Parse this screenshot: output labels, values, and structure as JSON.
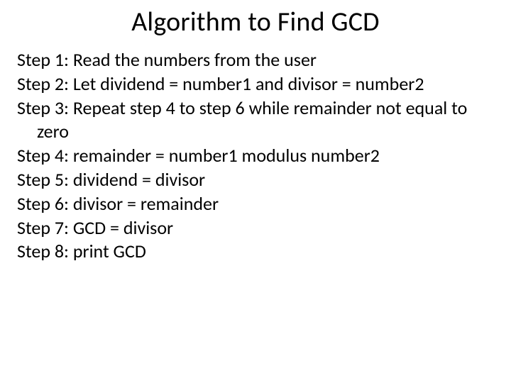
{
  "title": "Algorithm to Find GCD",
  "steps": {
    "s1": "Step 1: Read the numbers from the user",
    "s2": "Step 2: Let dividend = number1 and divisor = number2",
    "s3": "Step 3: Repeat step 4 to step 6 while remainder not equal to zero",
    "s4": "Step 4: remainder = number1 modulus number2",
    "s5": "Step 5: dividend = divisor",
    "s6": "Step 6: divisor = remainder",
    "s7": "Step 7: GCD = divisor",
    "s8": "Step 8: print GCD"
  }
}
